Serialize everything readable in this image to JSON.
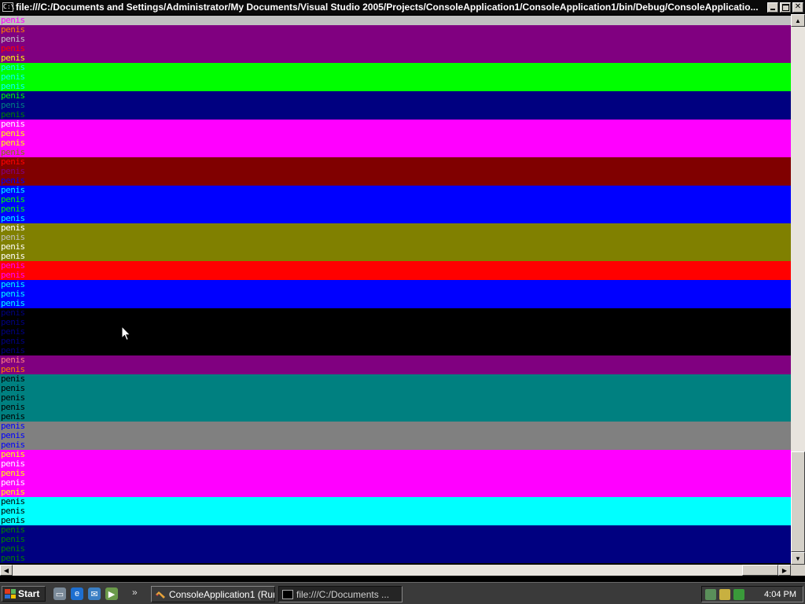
{
  "window": {
    "title": "file:///C:/Documents and Settings/Administrator/My Documents/Visual Studio 2005/Projects/ConsoleApplication1/ConsoleApplication1/bin/Debug/ConsoleApplicatio...",
    "icon_name": "console-icon",
    "icon_text": "C:\\",
    "controls": [
      "minimize-icon",
      "restore-icon",
      "close-icon"
    ]
  },
  "console": {
    "line_text": "penis",
    "bands": [
      {
        "color": "#c0c0c0",
        "rows": 1
      },
      {
        "color": "#800080",
        "rows": 4
      },
      {
        "color": "#00ff00",
        "rows": 3
      },
      {
        "color": "#000080",
        "rows": 3
      },
      {
        "color": "#ff00ff",
        "rows": 4
      },
      {
        "color": "#800000",
        "rows": 3
      },
      {
        "color": "#0000ff",
        "rows": 4
      },
      {
        "color": "#808000",
        "rows": 4
      },
      {
        "color": "#ff0000",
        "rows": 2
      },
      {
        "color": "#0000ff",
        "rows": 3
      },
      {
        "color": "#000000",
        "rows": 5
      },
      {
        "color": "#800080",
        "rows": 2
      },
      {
        "color": "#008080",
        "rows": 5
      },
      {
        "color": "#808080",
        "rows": 3
      },
      {
        "color": "#ff00ff",
        "rows": 5
      },
      {
        "color": "#00ffff",
        "rows": 3
      },
      {
        "color": "#000080",
        "rows": 4
      }
    ],
    "lines": [
      {
        "fg": "#ff00ff",
        "bg": "#c0c0c0"
      },
      {
        "fg": "#ff8000",
        "bg": "#800080"
      },
      {
        "fg": "#c0c0c0",
        "bg": "#800080"
      },
      {
        "fg": "#ff0000",
        "bg": "#800080"
      },
      {
        "fg": "#ffff00",
        "bg": "#800080"
      },
      {
        "fg": "#00ffff",
        "bg": "#00ff00"
      },
      {
        "fg": "#00ffff",
        "bg": "#00ff00"
      },
      {
        "fg": "#00ffff",
        "bg": "#00ff00"
      },
      {
        "fg": "#00ff00",
        "bg": "#000080"
      },
      {
        "fg": "#008080",
        "bg": "#000080"
      },
      {
        "fg": "#008000",
        "bg": "#000080"
      },
      {
        "fg": "#ffffff",
        "bg": "#ff00ff"
      },
      {
        "fg": "#ffff00",
        "bg": "#ff00ff"
      },
      {
        "fg": "#ffff00",
        "bg": "#ff00ff"
      },
      {
        "fg": "#808000",
        "bg": "#ff00ff"
      },
      {
        "fg": "#ff0000",
        "bg": "#800000"
      },
      {
        "fg": "#800080",
        "bg": "#800000"
      },
      {
        "fg": "#0000ff",
        "bg": "#800000"
      },
      {
        "fg": "#00ffff",
        "bg": "#0000ff"
      },
      {
        "fg": "#00ff00",
        "bg": "#0000ff"
      },
      {
        "fg": "#00ff00",
        "bg": "#0000ff"
      },
      {
        "fg": "#00ffff",
        "bg": "#0000ff"
      },
      {
        "fg": "#ffffff",
        "bg": "#808000"
      },
      {
        "fg": "#c0c0c0",
        "bg": "#808000"
      },
      {
        "fg": "#ffffff",
        "bg": "#808000"
      },
      {
        "fg": "#ffffff",
        "bg": "#808000"
      },
      {
        "fg": "#ff00ff",
        "bg": "#ff0000"
      },
      {
        "fg": "#ff00ff",
        "bg": "#ff0000"
      },
      {
        "fg": "#00ffff",
        "bg": "#0000ff"
      },
      {
        "fg": "#00ffff",
        "bg": "#0000ff"
      },
      {
        "fg": "#00ffff",
        "bg": "#0000ff"
      },
      {
        "fg": "#000080",
        "bg": "#000000"
      },
      {
        "fg": "#000080",
        "bg": "#000000"
      },
      {
        "fg": "#000080",
        "bg": "#000000"
      },
      {
        "fg": "#000080",
        "bg": "#000000"
      },
      {
        "fg": "#000080",
        "bg": "#000000"
      },
      {
        "fg": "#ff8080",
        "bg": "#800080"
      },
      {
        "fg": "#ff8000",
        "bg": "#800080"
      },
      {
        "fg": "#000000",
        "bg": "#008080"
      },
      {
        "fg": "#000000",
        "bg": "#008080"
      },
      {
        "fg": "#000000",
        "bg": "#008080"
      },
      {
        "fg": "#000000",
        "bg": "#008080"
      },
      {
        "fg": "#000000",
        "bg": "#008080"
      },
      {
        "fg": "#0000ff",
        "bg": "#808080"
      },
      {
        "fg": "#0000ff",
        "bg": "#808080"
      },
      {
        "fg": "#0000ff",
        "bg": "#808080"
      },
      {
        "fg": "#ffff00",
        "bg": "#ff00ff"
      },
      {
        "fg": "#ffffff",
        "bg": "#ff00ff"
      },
      {
        "fg": "#ffff00",
        "bg": "#ff00ff"
      },
      {
        "fg": "#ffffff",
        "bg": "#ff00ff"
      },
      {
        "fg": "#ffff00",
        "bg": "#ff00ff"
      },
      {
        "fg": "#000000",
        "bg": "#00ffff"
      },
      {
        "fg": "#000000",
        "bg": "#00ffff"
      },
      {
        "fg": "#000000",
        "bg": "#00ffff"
      },
      {
        "fg": "#008000",
        "bg": "#000080"
      },
      {
        "fg": "#008000",
        "bg": "#000080"
      },
      {
        "fg": "#008000",
        "bg": "#000080"
      },
      {
        "fg": "#008000",
        "bg": "#000080"
      }
    ]
  },
  "scrollbars": {
    "up": "▲",
    "down": "▼",
    "left": "◀",
    "right": "▶"
  },
  "taskbar": {
    "start_label": "Start",
    "quick_launch": [
      "show-desktop-icon",
      "internet-explorer-icon",
      "outlook-express-icon",
      "windows-media-icon"
    ],
    "overflow": "»",
    "buttons": [
      {
        "label": "ConsoleApplication1 (Run...",
        "icon": "visual-studio-icon",
        "active": false
      },
      {
        "label": "file:///C:/Documents ...",
        "icon": "console-icon",
        "active": true
      }
    ],
    "tray_icons": [
      "network-icon",
      "volume-icon",
      "security-icon"
    ],
    "clock": "4:04 PM"
  }
}
